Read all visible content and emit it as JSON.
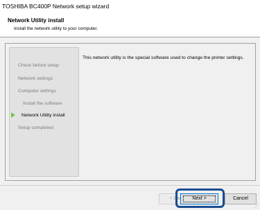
{
  "window": {
    "title": "TOSHIBA BC400P Network setup wizard"
  },
  "header": {
    "title": "Network Utility install",
    "subtitle": "Install the network utility to your computer."
  },
  "steps": [
    {
      "label": "Check before setup"
    },
    {
      "label": "Network settings"
    },
    {
      "label": "Computer settings"
    },
    {
      "label": "Install the software"
    },
    {
      "label": "Network Utility install",
      "active": true
    },
    {
      "label": "Setup completed"
    }
  ],
  "description": "This network utility is the special software used to change the printer settings.",
  "buttons": {
    "back": "< Back",
    "next": "Next >",
    "cancel": "Cancel"
  },
  "colors": {
    "active_arrow": "#7dc24b",
    "highlight": "#1a4c92"
  }
}
